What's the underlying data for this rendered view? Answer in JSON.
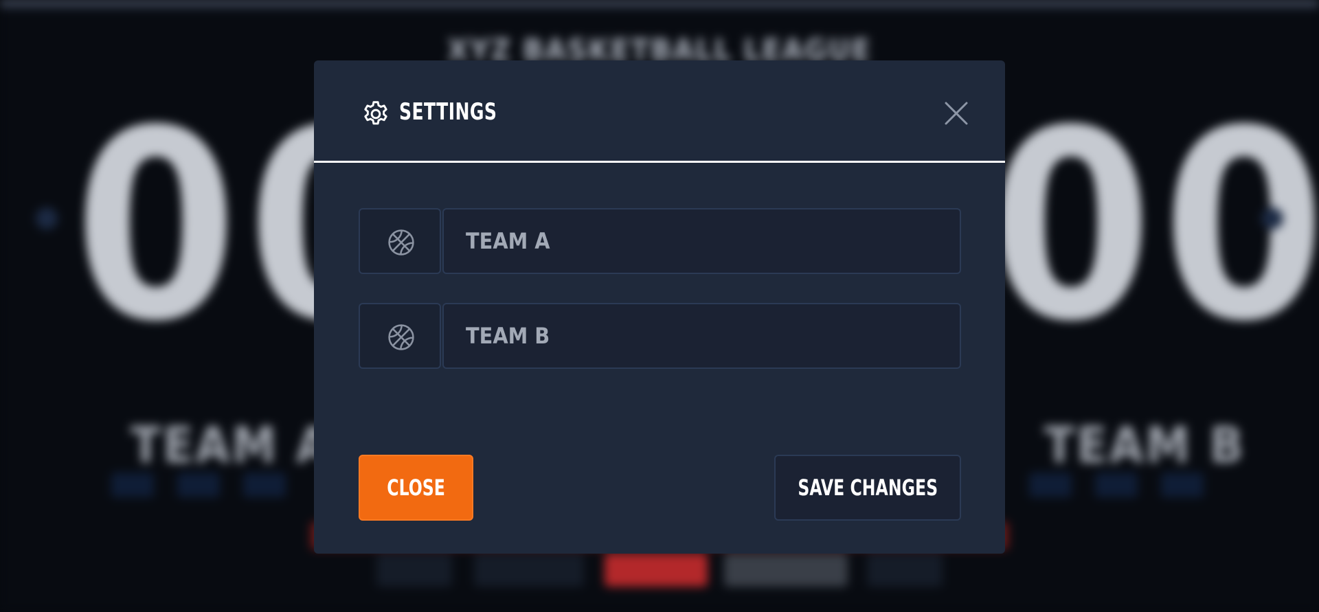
{
  "background": {
    "league_title": "XYZ BASKETBALL LEAGUE",
    "home_score": "00",
    "away_score": "00",
    "home_team": "TEAM A",
    "away_team": "TEAM B"
  },
  "modal": {
    "title": "SETTINGS",
    "title_icon": "gear-icon",
    "close_icon": "close-icon",
    "fields": [
      {
        "icon": "basketball-icon",
        "placeholder": "TEAM A",
        "value": ""
      },
      {
        "icon": "basketball-icon",
        "placeholder": "TEAM B",
        "value": ""
      }
    ],
    "buttons": {
      "close_label": "CLOSE",
      "save_label": "SAVE CHANGES"
    }
  },
  "colors": {
    "modal_bg": "#1f293b",
    "accent": "#f26a11",
    "input_bg": "#1b2233",
    "border": "#2b3a55"
  }
}
